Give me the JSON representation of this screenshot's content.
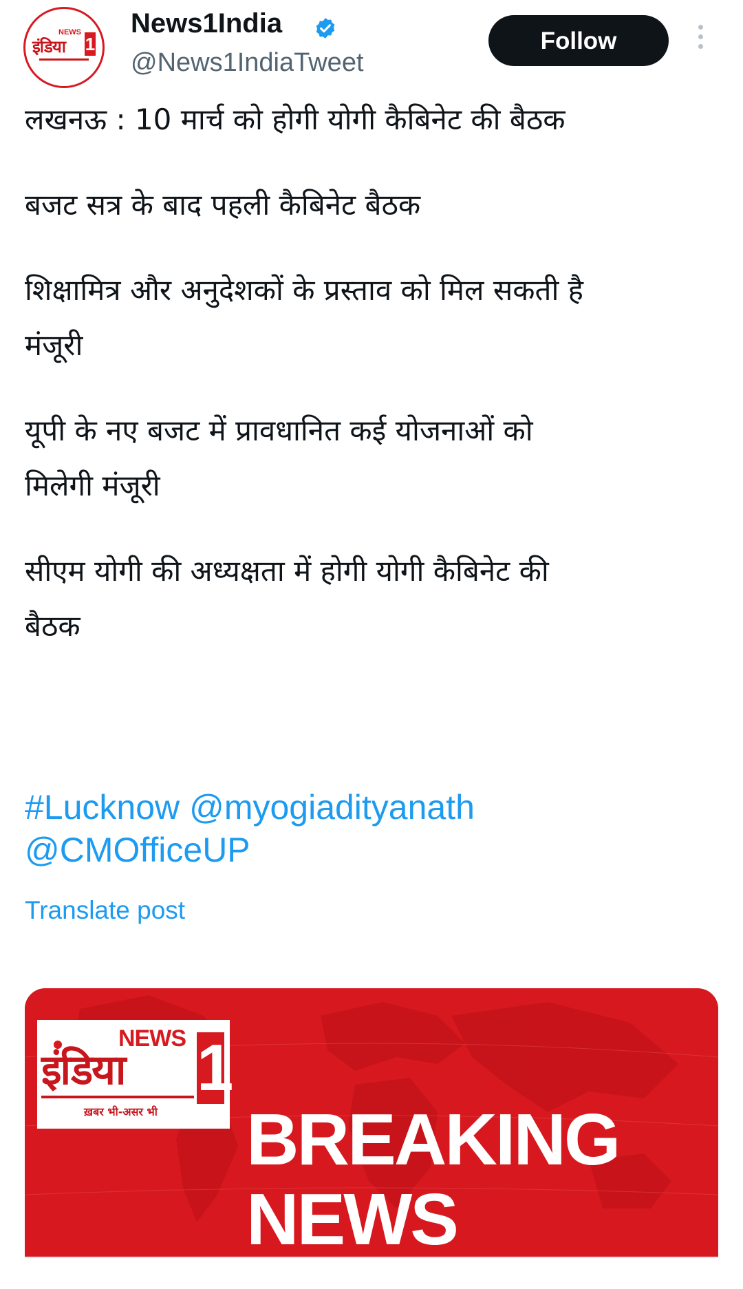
{
  "tweet": {
    "author_name": "News1India",
    "author_handle": "@News1IndiaTweet",
    "verified_color": "#1d9bf0",
    "follow_label": "Follow",
    "avatar": {
      "news_text": "NEWS",
      "hindi_text": "इंडिया",
      "one_text": "1"
    },
    "lines": [
      "लखनऊ : 10 मार्च को होगी योगी कैबिनेट की बैठक",
      "बजट सत्र के बाद पहली कैबिनेट बैठक",
      "शिक्षामित्र और अनुदेशकों के प्रस्ताव को मिल सकती है",
      "मंजूरी",
      "यूपी के नए बजट में प्रावधानित कई योजनाओं को",
      "मिलेगी मंजूरी",
      "सीएम योगी की अध्यक्षता में होगी योगी कैबिनेट की",
      "बैठक"
    ],
    "hashtags": [
      "#Lucknow",
      "@myogiadityanath",
      "@CMOfficeUP"
    ],
    "translate_label": "Translate post",
    "link_color": "#1d9bf0"
  },
  "media": {
    "background_color": "#d7191f",
    "logo": {
      "news_text": "NEWS",
      "hindi_text": "इंडिया",
      "one_text": "1",
      "tagline": "ख़बर भी-असर भी"
    },
    "headline_line1": "BREAKING",
    "headline_line2": "NEWS"
  }
}
